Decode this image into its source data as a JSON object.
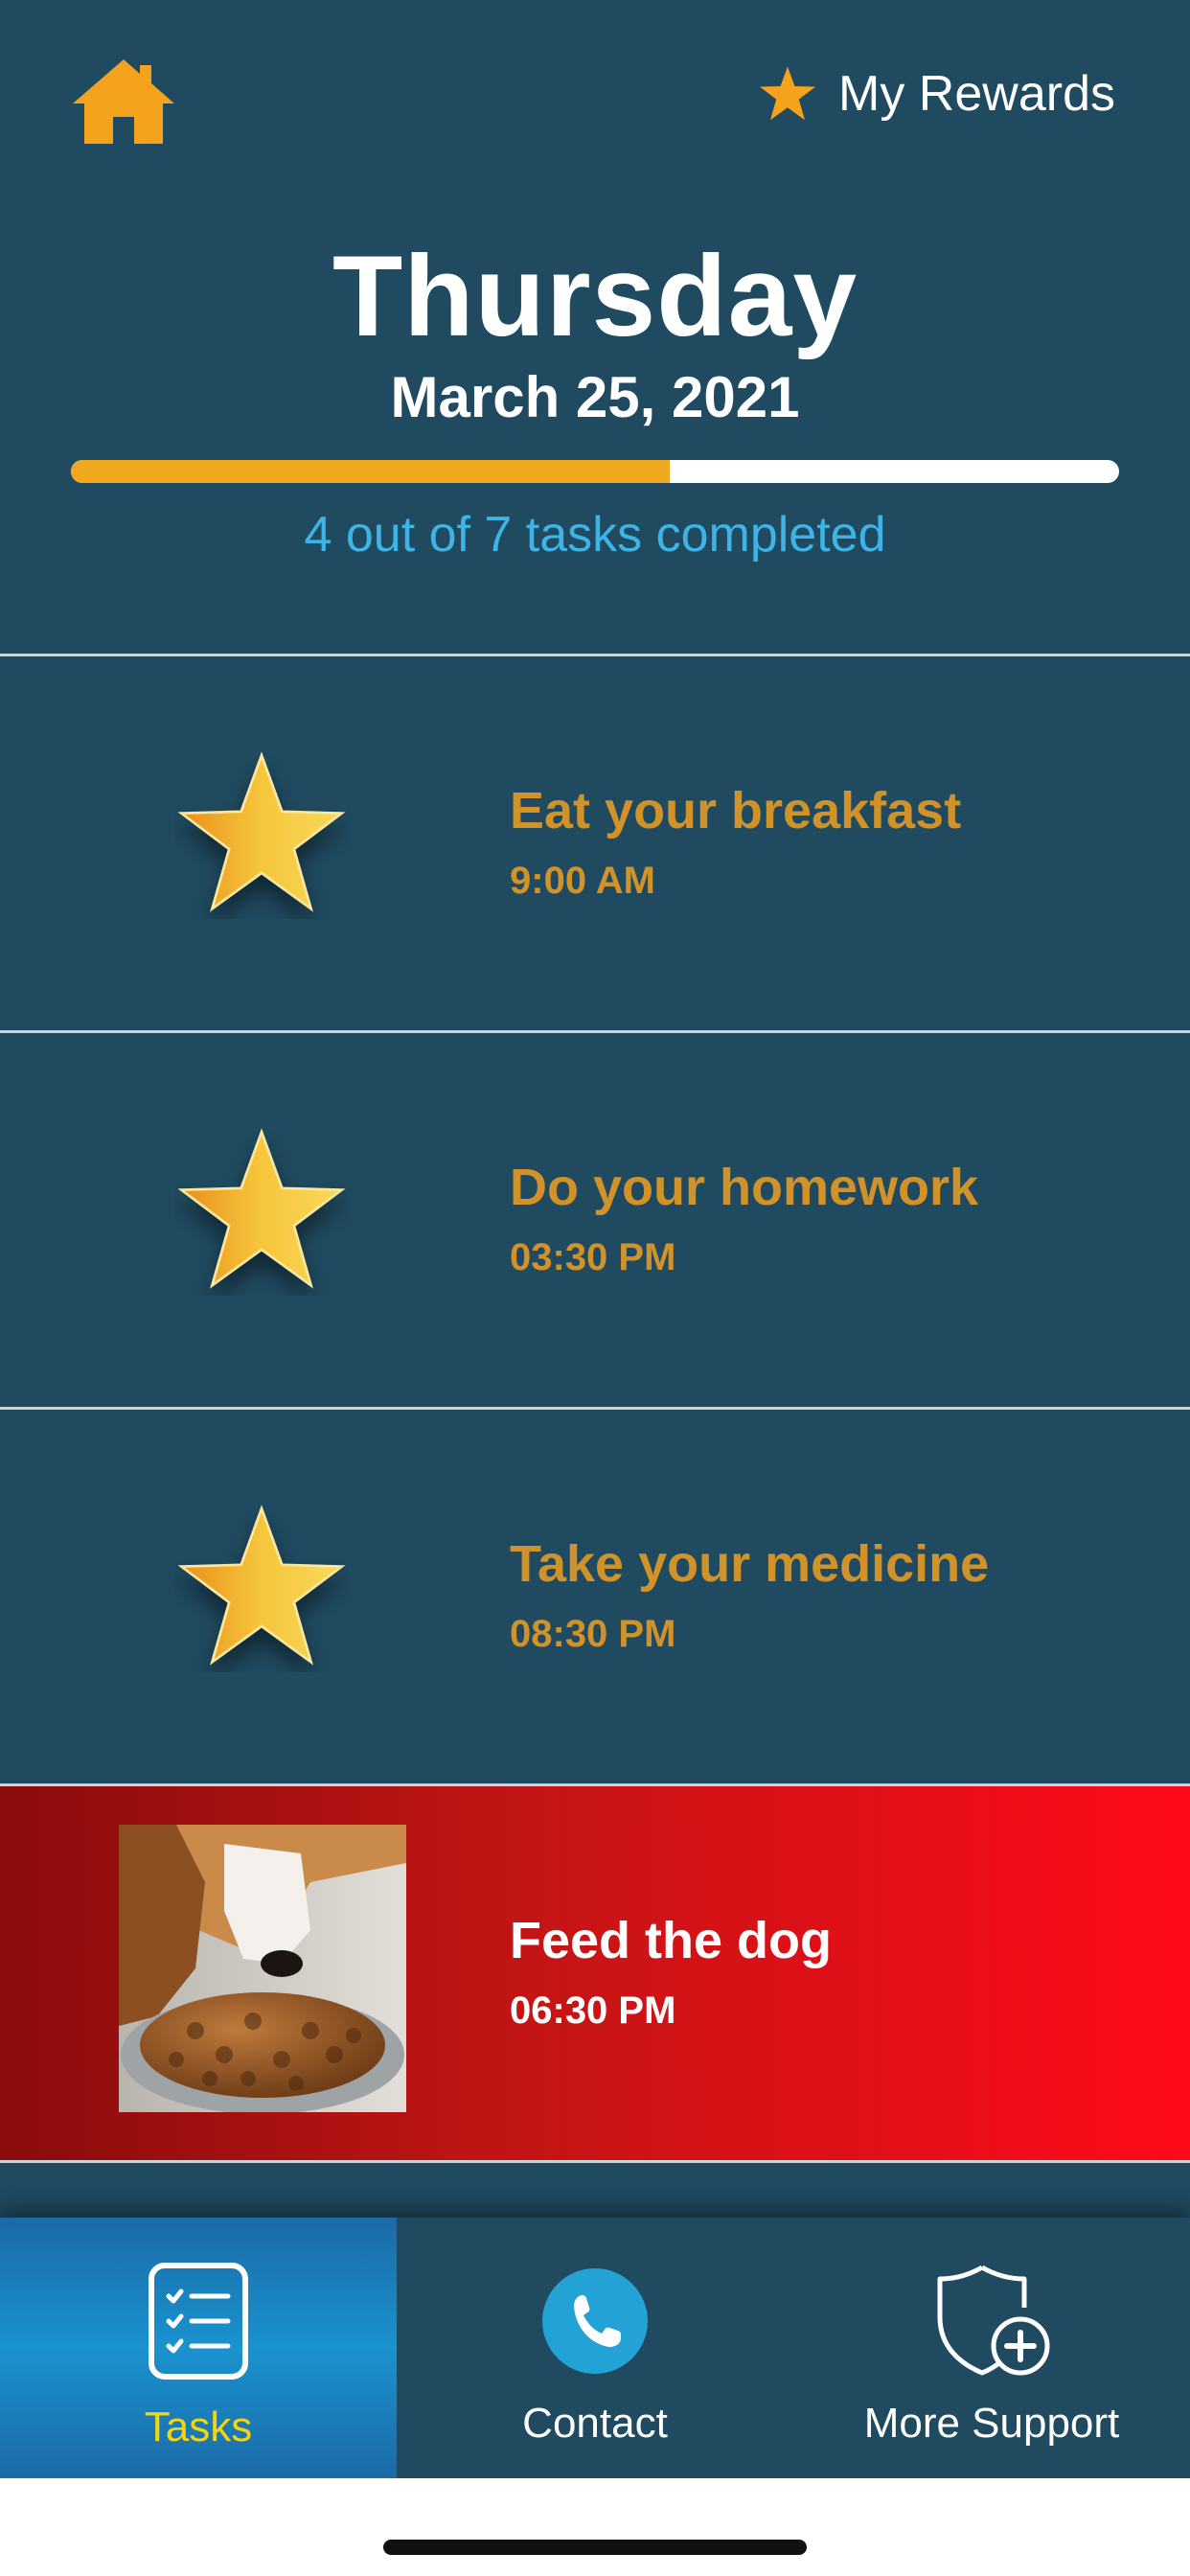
{
  "header": {
    "home_icon": "home-icon",
    "rewards_label": "My Rewards",
    "rewards_icon": "star-icon"
  },
  "day": {
    "weekday": "Thursday",
    "date": "March 25, 2021"
  },
  "progress": {
    "completed": 4,
    "total": 7,
    "fraction": 0.571,
    "text": "4 out of 7 tasks completed",
    "fill_color": "#f0a81f"
  },
  "tasks": [
    {
      "title": "Eat your breakfast",
      "time": "9:00 AM",
      "icon": "star-icon",
      "highlighted": false
    },
    {
      "title": "Do your homework",
      "time": "03:30 PM",
      "icon": "star-icon",
      "highlighted": false
    },
    {
      "title": "Take your medicine",
      "time": "08:30 PM",
      "icon": "star-icon",
      "highlighted": false
    },
    {
      "title": "Feed the dog",
      "time": "06:30 PM",
      "icon": "dog-food-photo",
      "highlighted": true
    }
  ],
  "nav": {
    "tasks_label": "Tasks",
    "contact_label": "Contact",
    "support_label": "More Support",
    "active": "Tasks"
  },
  "colors": {
    "background": "#1f4a5f",
    "accent": "#f0a81f",
    "task_text": "#d1922a",
    "progress_text": "#3db3e6",
    "active_tab_label": "#f3d40f",
    "highlight_red": "#ff0a1a"
  }
}
